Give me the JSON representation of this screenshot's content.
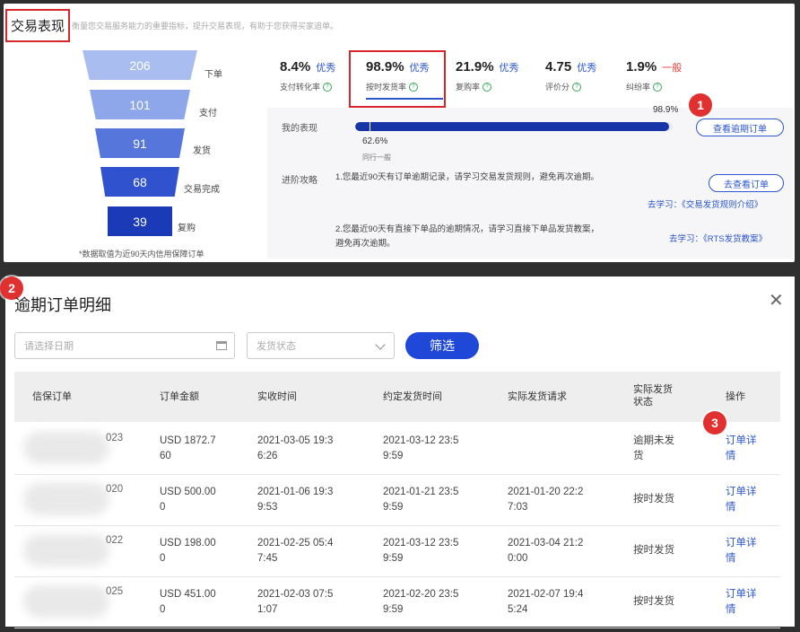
{
  "section": {
    "title": "交易表现",
    "subtitle": "衡量您交易服务能力的重要指标，提升交易表现，有助于您获得买家追单。"
  },
  "funnel": {
    "colors": [
      "#a9bdf0",
      "#8ea6ea",
      "#5676db",
      "#3052cf",
      "#1a3ab8"
    ],
    "stages": [
      {
        "value": "206",
        "label": "下单"
      },
      {
        "value": "101",
        "label": "支付"
      },
      {
        "value": "91",
        "label": "发货"
      },
      {
        "value": "68",
        "label": "交易完成"
      },
      {
        "value": "39",
        "label": "复购"
      }
    ],
    "note": "*数据取值为近90天内信用保障订单"
  },
  "metrics": [
    {
      "value": "8.4%",
      "grade": "优秀",
      "name": "支付转化率"
    },
    {
      "value": "98.9%",
      "grade": "优秀",
      "name": "按时发货率"
    },
    {
      "value": "21.9%",
      "grade": "优秀",
      "name": "复购率"
    },
    {
      "value": "4.75",
      "grade": "优秀",
      "name": "评价分"
    },
    {
      "value": "1.9%",
      "grade": "一般",
      "name": "纠纷率"
    }
  ],
  "colors": {
    "accent": "#2b56cc",
    "bar": "#1735a6",
    "highlight": "#d9262d",
    "warning": "#e03a3a"
  },
  "performance": {
    "label": "我的表现",
    "my_value": "98.9%",
    "my_fraction": 0.989,
    "peer_value": "62.6%",
    "peer_label": "同行一般",
    "button": "查看逾期订单"
  },
  "strategy": {
    "label": "进阶攻略",
    "tip1": "1.您最近90天有订单逾期记录，请学习交易发货规则，避免再次逾期。",
    "tip1_button": "去查看订单",
    "learn1_prefix": "去学习：",
    "learn1_link": "《交易发货规则介绍》",
    "tip2_line1": "2.您最近90天有直接下单品的逾期情况，请学习直接下单品发货教案，",
    "tip2_line2": "避免再次逾期。",
    "learn2_prefix": "去学习：",
    "learn2_link": "《RTS发货教案》"
  },
  "badges": [
    "1",
    "2",
    "3"
  ],
  "modal": {
    "title": "逾期订单明细",
    "date_placeholder": "请选择日期",
    "status_placeholder": "发货状态",
    "filter_button": "筛选",
    "columns": {
      "order": "信保订单",
      "amount": "订单金额",
      "received": "实收时间",
      "promised": "约定发货时间",
      "actual_request": "实际发货请求",
      "status_l1": "实际发货",
      "status_l2": "状态",
      "action": "操作"
    },
    "rows": [
      {
        "id_tail": "023",
        "amount_l1": "USD 1872.7",
        "amount_l2": "60",
        "received_l1": "2021-03-05 19:3",
        "received_l2": "6:26",
        "promised_l1": "2021-03-12 23:5",
        "promised_l2": "9:59",
        "actual_l1": "",
        "actual_l2": "",
        "status_l1": "逾期未发",
        "status_l2": "货",
        "action_l1": "订单详",
        "action_l2": "情"
      },
      {
        "id_tail": "020",
        "amount_l1": "USD 500.00",
        "amount_l2": "0",
        "received_l1": "2021-01-06 19:3",
        "received_l2": "9:53",
        "promised_l1": "2021-01-21 23:5",
        "promised_l2": "9:59",
        "actual_l1": "2021-01-20 22:2",
        "actual_l2": "7:03",
        "status_l1": "按时发货",
        "status_l2": "",
        "action_l1": "订单详",
        "action_l2": "情"
      },
      {
        "id_tail": "022",
        "amount_l1": "USD 198.00",
        "amount_l2": "0",
        "received_l1": "2021-02-25 05:4",
        "received_l2": "7:45",
        "promised_l1": "2021-03-12 23:5",
        "promised_l2": "9:59",
        "actual_l1": "2021-03-04 21:2",
        "actual_l2": "0:00",
        "status_l1": "按时发货",
        "status_l2": "",
        "action_l1": "订单详",
        "action_l2": "情"
      },
      {
        "id_tail": "025",
        "amount_l1": "USD 451.00",
        "amount_l2": "0",
        "received_l1": "2021-02-03 07:5",
        "received_l2": "1:07",
        "promised_l1": "2021-02-20 23:5",
        "promised_l2": "9:59",
        "actual_l1": "2021-02-07 19:4",
        "actual_l2": "5:24",
        "status_l1": "按时发货",
        "status_l2": "",
        "action_l1": "订单详",
        "action_l2": "情"
      }
    ]
  }
}
